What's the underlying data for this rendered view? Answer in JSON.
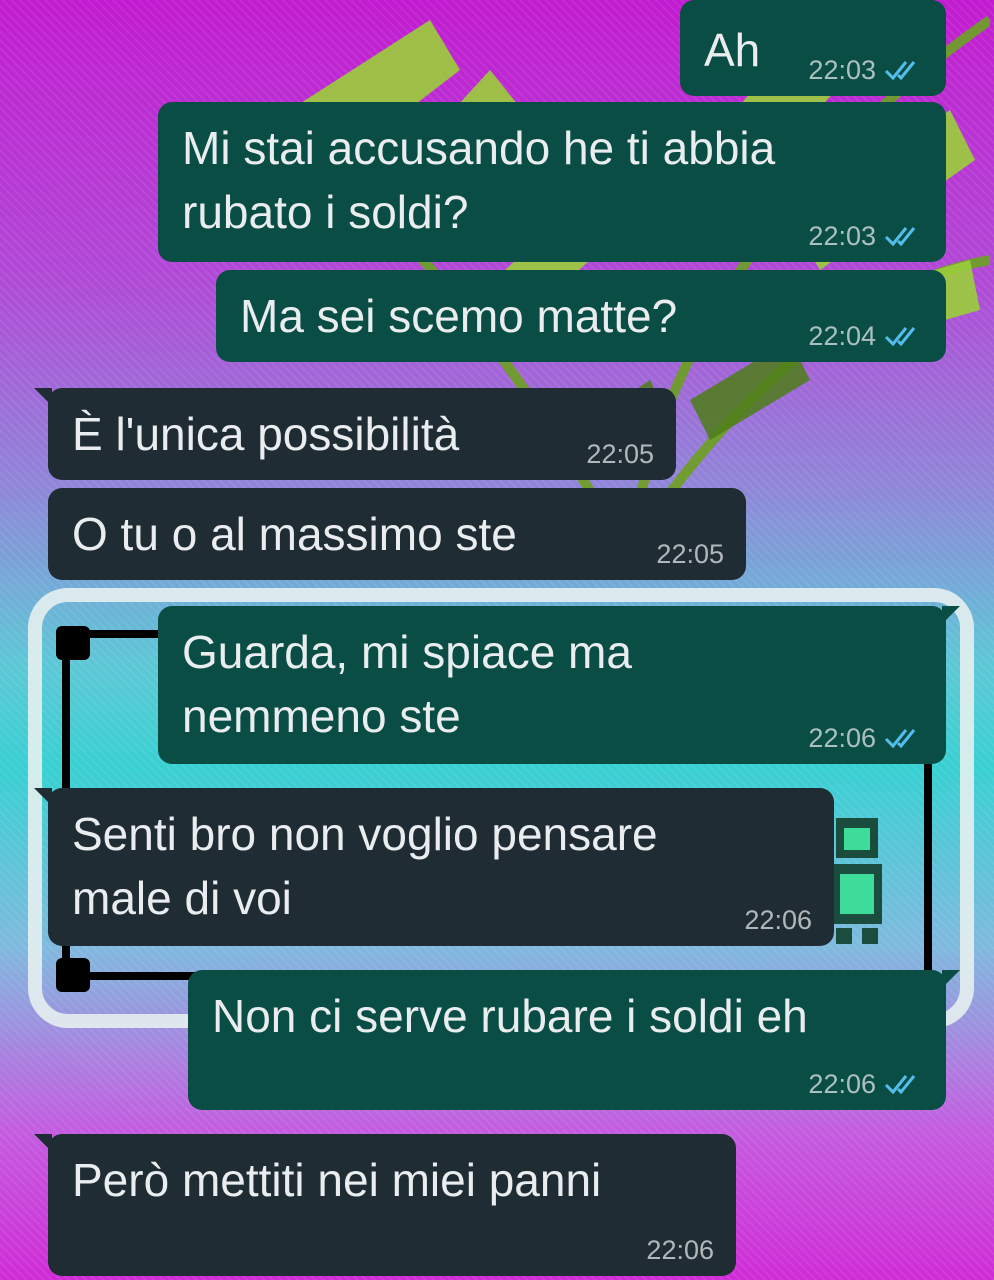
{
  "colors": {
    "incoming_bubble": "#1f2c34",
    "outgoing_bubble": "#0a4d45",
    "text": "#e9edef",
    "read_tick": "#53bdeb"
  },
  "messages": [
    {
      "text": "Ah",
      "time": "22:03",
      "direction": "outgoing",
      "status": "read"
    },
    {
      "text": "Mi stai accusando he ti abbia\nrubato i soldi?",
      "time": "22:03",
      "direction": "outgoing",
      "status": "read"
    },
    {
      "text": "Ma sei scemo matte?",
      "time": "22:04",
      "direction": "outgoing",
      "status": "read"
    },
    {
      "text": "È l'unica possibilità",
      "time": "22:05",
      "direction": "incoming"
    },
    {
      "text": "O tu o al massimo ste",
      "time": "22:05",
      "direction": "incoming"
    },
    {
      "text": "Guarda, mi spiace ma\nnemmeno ste",
      "time": "22:06",
      "direction": "outgoing",
      "status": "read"
    },
    {
      "text": "Senti bro non voglio pensare\nmale di voi",
      "time": "22:06",
      "direction": "incoming"
    },
    {
      "text": "Non ci serve rubare i soldi eh",
      "time": "22:06",
      "direction": "outgoing",
      "status": "read"
    },
    {
      "text": "Però mettiti nei miei panni",
      "time": "22:06",
      "direction": "incoming"
    }
  ],
  "icons": {
    "read": "double-check-icon"
  }
}
